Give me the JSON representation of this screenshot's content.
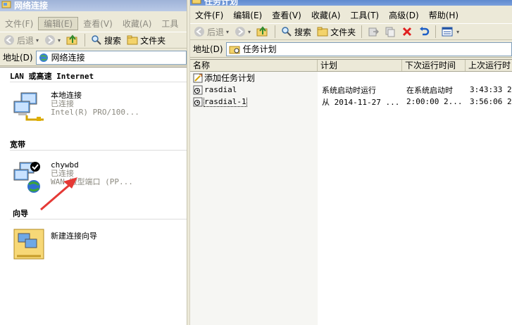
{
  "left": {
    "title": "网络连接",
    "menu": [
      "文件(F)",
      "编辑(E)",
      "查看(V)",
      "收藏(A)",
      "工具"
    ],
    "toolbar": {
      "back": "后退",
      "search": "搜索",
      "folders": "文件夹"
    },
    "address": {
      "label": "地址(D)",
      "value": "网络连接"
    },
    "groups": [
      {
        "title": "LAN 或高速 Internet",
        "items": [
          {
            "name": "本地连接",
            "status": "已连接",
            "detail": "Intel(R) PRO/100..."
          }
        ]
      },
      {
        "title": "宽带",
        "items": [
          {
            "name": "chywbd",
            "status": "已连接",
            "detail": "WAN 微型端口 (PP..."
          }
        ]
      },
      {
        "title": "向导",
        "items": [
          {
            "name": "新建连接向导",
            "status": "",
            "detail": ""
          }
        ]
      }
    ]
  },
  "right": {
    "title": "任务计划",
    "menu": [
      "文件(F)",
      "编辑(E)",
      "查看(V)",
      "收藏(A)",
      "工具(T)",
      "高级(D)",
      "帮助(H)"
    ],
    "toolbar": {
      "back": "后退",
      "search": "搜索",
      "folders": "文件夹"
    },
    "address": {
      "label": "地址(D)",
      "value": "任务计划"
    },
    "columns": [
      "名称",
      "计划",
      "下次运行时间",
      "上次运行时"
    ],
    "rows": [
      {
        "name": "添加任务计划",
        "schedule": "",
        "next": "",
        "last": ""
      },
      {
        "name": "rasdial",
        "schedule": "系统启动时运行",
        "next": "在系统启动时",
        "last": "3:43:33  2"
      },
      {
        "name": "rasdial-1",
        "schedule": "从 2014-11-27 ...",
        "next": "2:00:00  2...",
        "last": "3:56:06  2"
      }
    ]
  },
  "colors": {
    "title_active": "#4b79c4",
    "title_inactive": "#9bb0d6",
    "annotation_arrow": "#e53935"
  }
}
